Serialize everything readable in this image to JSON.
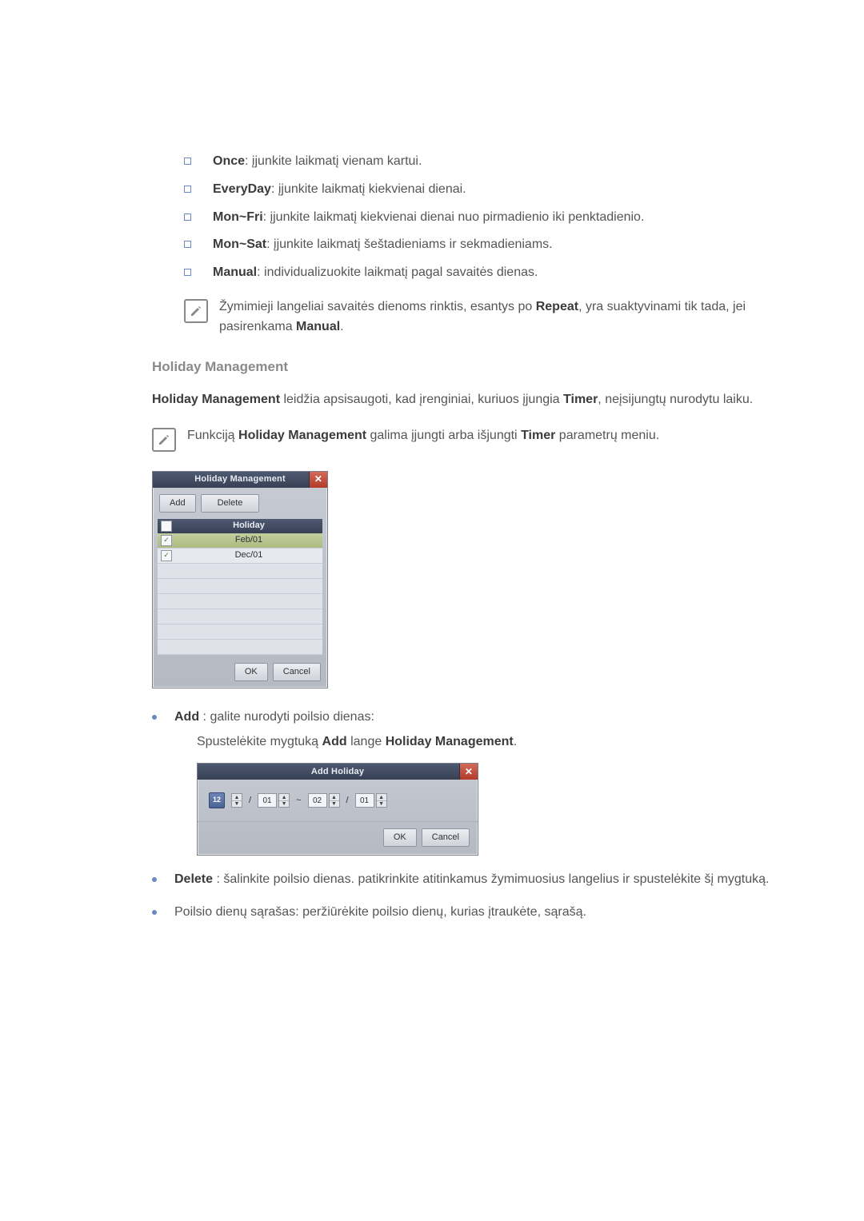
{
  "repeat_options": [
    {
      "label": "Once",
      "desc": ": įjunkite laikmatį vienam kartui."
    },
    {
      "label": "EveryDay",
      "desc": ": įjunkite laikmatį kiekvienai dienai."
    },
    {
      "label": "Mon~Fri",
      "desc": ": įjunkite laikmatį kiekvienai dienai nuo pirmadienio iki penktadienio."
    },
    {
      "label": "Mon~Sat",
      "desc": ": įjunkite laikmatį šeštadieniams ir sekmadieniams."
    },
    {
      "label": "Manual",
      "desc": ": individualizuokite laikmatį pagal savaitės dienas."
    }
  ],
  "note_manual": {
    "prefix": "Žymimieji langeliai savaitės dienoms rinktis, esantys po ",
    "bold": "Repeat",
    "mid": ", yra suaktyvinami tik tada, jei pasirenkama ",
    "bold2": "Manual",
    "suffix": "."
  },
  "hm_heading": "Holiday Management",
  "hm_para": {
    "b1": "Holiday Management",
    "t1": " leidžia apsisaugoti, kad įrenginiai, kuriuos įjungia ",
    "b2": "Timer",
    "t2": ", neįsijungtų nurodytu laiku."
  },
  "hm_note": {
    "t1": "Funkciją ",
    "b1": "Holiday Management",
    "t2": " galima įjungti arba išjungti ",
    "b2": "Timer",
    "t3": " parametrų meniu."
  },
  "hm_window": {
    "title": "Holiday Management",
    "close": "✕",
    "add": "Add",
    "delete": "Delete",
    "col_holiday": "Holiday",
    "rows": [
      {
        "checked": true,
        "label": "Feb/01",
        "selected": true
      },
      {
        "checked": true,
        "label": "Dec/01",
        "selected": false
      }
    ],
    "empty_rows": 6,
    "ok": "OK",
    "cancel": "Cancel"
  },
  "add_bullet": {
    "b": "Add",
    "t": " : galite nurodyti poilsio dienas:"
  },
  "add_hint": {
    "t1": "Spustelėkite mygtuką ",
    "b1": "Add",
    "t2": " lange ",
    "b2": "Holiday Management",
    "t3": "."
  },
  "ah_window": {
    "title": "Add Holiday",
    "close": "✕",
    "cal_icon": "12",
    "from_m": "",
    "from_d": "01",
    "to_m": "02",
    "to_d": "01",
    "tilde": "~",
    "slash": "/",
    "ok": "OK",
    "cancel": "Cancel"
  },
  "delete_bullet": {
    "b": "Delete",
    "t": " : šalinkite poilsio dienas. patikrinkite atitinkamus žymimuosius langelius ir spustelėkite šį mygtuką."
  },
  "list_bullet": "Poilsio dienų sąrašas: peržiūrėkite poilsio dienų, kurias įtraukėte, sąrašą."
}
